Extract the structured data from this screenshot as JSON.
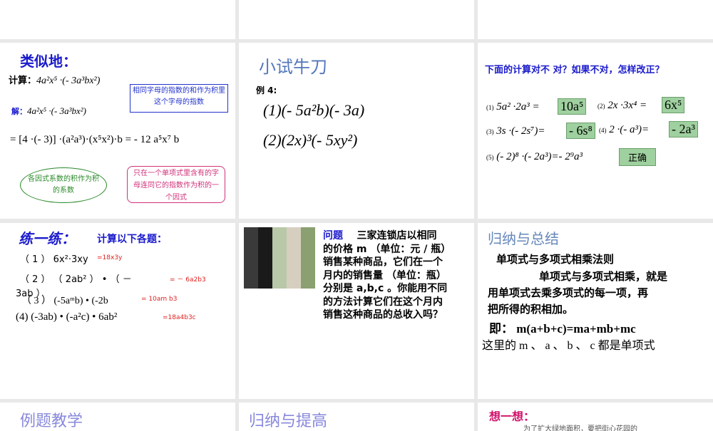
{
  "slides": [
    {
      "title": "类似地：",
      "calc_label": "计算：",
      "calc_expr": "4a²x⁵ ·(- 3a³bx²)",
      "solve_label": "解：",
      "solve_expr": "4a²x⁵ ·(- 3a³bx²)",
      "step_expr": "= [4 ·(- 3)] ·(a²a³)·(x⁵x²)·b = - 12 a⁵x⁷ b",
      "callout_blue": "相同字母的指数的和作为积里这个字母的指数",
      "callout_green": "各因式系数的积作为积的系数",
      "callout_pink": "只在一个单项式里含有的字母连同它的指数作为积的一个因式"
    },
    {
      "title": "小试牛刀",
      "example": "例 4:",
      "line1": "(1)(- 5a²b)(- 3a)",
      "line2": "(2)(2x)³(- 5xy²)"
    },
    {
      "title": "下面的计算对不 对？如果不对，怎样改正？",
      "items": [
        {
          "num": "(1)",
          "expr": "5a² ·2a³ =",
          "answer": "10a⁵"
        },
        {
          "num": "(2)",
          "expr": "2x ·3x⁴ =",
          "answer": "6x⁵"
        },
        {
          "num": "(3)",
          "expr": "3s ·(- 2s⁷)=",
          "answer": "- 6s⁸"
        },
        {
          "num": "(4)",
          "expr": "2 ·(- a³)=",
          "answer": "- 2a³"
        },
        {
          "num": "(5)",
          "expr": "(- 2)⁸ ·(- 2a³)=- 2⁹a³",
          "answer": "正确"
        }
      ]
    },
    {
      "title": "练一练：",
      "subtitle": "计算以下各题：",
      "rows": [
        {
          "q": "（ 1 ） 6x²·3xy",
          "a": "=18x3y"
        },
        {
          "q": "（ 2 ） （ 2ab² ） • （ －",
          "a": "= － 6a2b3"
        },
        {
          "q": "3ab ）",
          "a": ""
        },
        {
          "q": "（ 3 ） (-5aᵐb) • (-2b",
          "a": "= 10am b3"
        },
        {
          "q": "(4) (-3ab) • (-a²c) • 6ab²",
          "a": "=18a4b3c"
        }
      ]
    },
    {
      "label": "问题",
      "text": [
        "三家连锁店以相同",
        "的价格 m （单位：元 / 瓶）",
        "销售某种商品，它们在一个",
        "月内的销售量 （单位：瓶）",
        "分别是 a,b,c 。你能用不同",
        "的方法计算它们在这个月内",
        "销售这种商品的总收入吗？"
      ]
    },
    {
      "title": "归纳与总结",
      "rule_title": "单项式与多项式相乘法则",
      "rule": [
        "单项式与多项式相乘，就是",
        "用单项式去乘多项式的每一项，再",
        "把所得的积相加。"
      ],
      "formula": "即： m(a+b+c)=ma+mb+mc",
      "note": "这里的 m 、 a 、 b 、 c 都是单项式"
    },
    {
      "title": "例题教学"
    },
    {
      "title": "归纳与提高"
    },
    {
      "title": "想一想：",
      "text": "为了扩大绿地面积，要把街心花园的"
    }
  ]
}
